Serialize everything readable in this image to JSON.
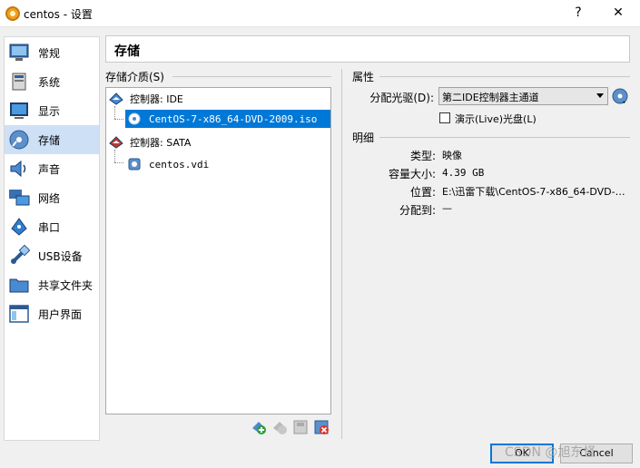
{
  "window": {
    "title": "centos - 设置",
    "help": "?",
    "close": "✕"
  },
  "sidebar": {
    "items": [
      {
        "label": "常规",
        "icon": "general-icon"
      },
      {
        "label": "系统",
        "icon": "system-icon"
      },
      {
        "label": "显示",
        "icon": "display-icon"
      },
      {
        "label": "存储",
        "icon": "storage-icon",
        "active": true
      },
      {
        "label": "声音",
        "icon": "audio-icon"
      },
      {
        "label": "网络",
        "icon": "network-icon"
      },
      {
        "label": "串口",
        "icon": "serial-port-icon"
      },
      {
        "label": "USB设备",
        "icon": "usb-icon"
      },
      {
        "label": "共享文件夹",
        "icon": "shared-folder-icon"
      },
      {
        "label": "用户界面",
        "icon": "user-interface-icon"
      }
    ]
  },
  "header": {
    "title": "存储"
  },
  "storage": {
    "section_label": "存储介质(S)",
    "tree": [
      {
        "label": "控制器: IDE",
        "type": "controller"
      },
      {
        "label": "CentOS-7-x86_64-DVD-2009.iso",
        "type": "optical",
        "selected": true
      },
      {
        "label": "控制器: SATA",
        "type": "controller"
      },
      {
        "label": "centos.vdi",
        "type": "disk"
      }
    ]
  },
  "attributes": {
    "section_label": "属性",
    "drive_label": "分配光驱(D):",
    "drive_value": "第二IDE控制器主通道",
    "live_cd_label": "演示(Live)光盘(L)",
    "live_cd_checked": false
  },
  "details": {
    "section_label": "明细",
    "rows": [
      {
        "label": "类型:",
        "value": "映像"
      },
      {
        "label": "容量大小:",
        "value": "4.39  GB"
      },
      {
        "label": "位置:",
        "value": "E:\\迅雷下载\\CentOS-7-x86_64-DVD-…"
      },
      {
        "label": "分配到:",
        "value": "—"
      }
    ]
  },
  "buttons": {
    "ok": "OK",
    "cancel": "Cancel"
  },
  "watermark": "CSDN @旭东怪",
  "colors": {
    "selection": "#0078d7",
    "nav_active": "#cde0f6",
    "border": "#a8a8a8"
  }
}
